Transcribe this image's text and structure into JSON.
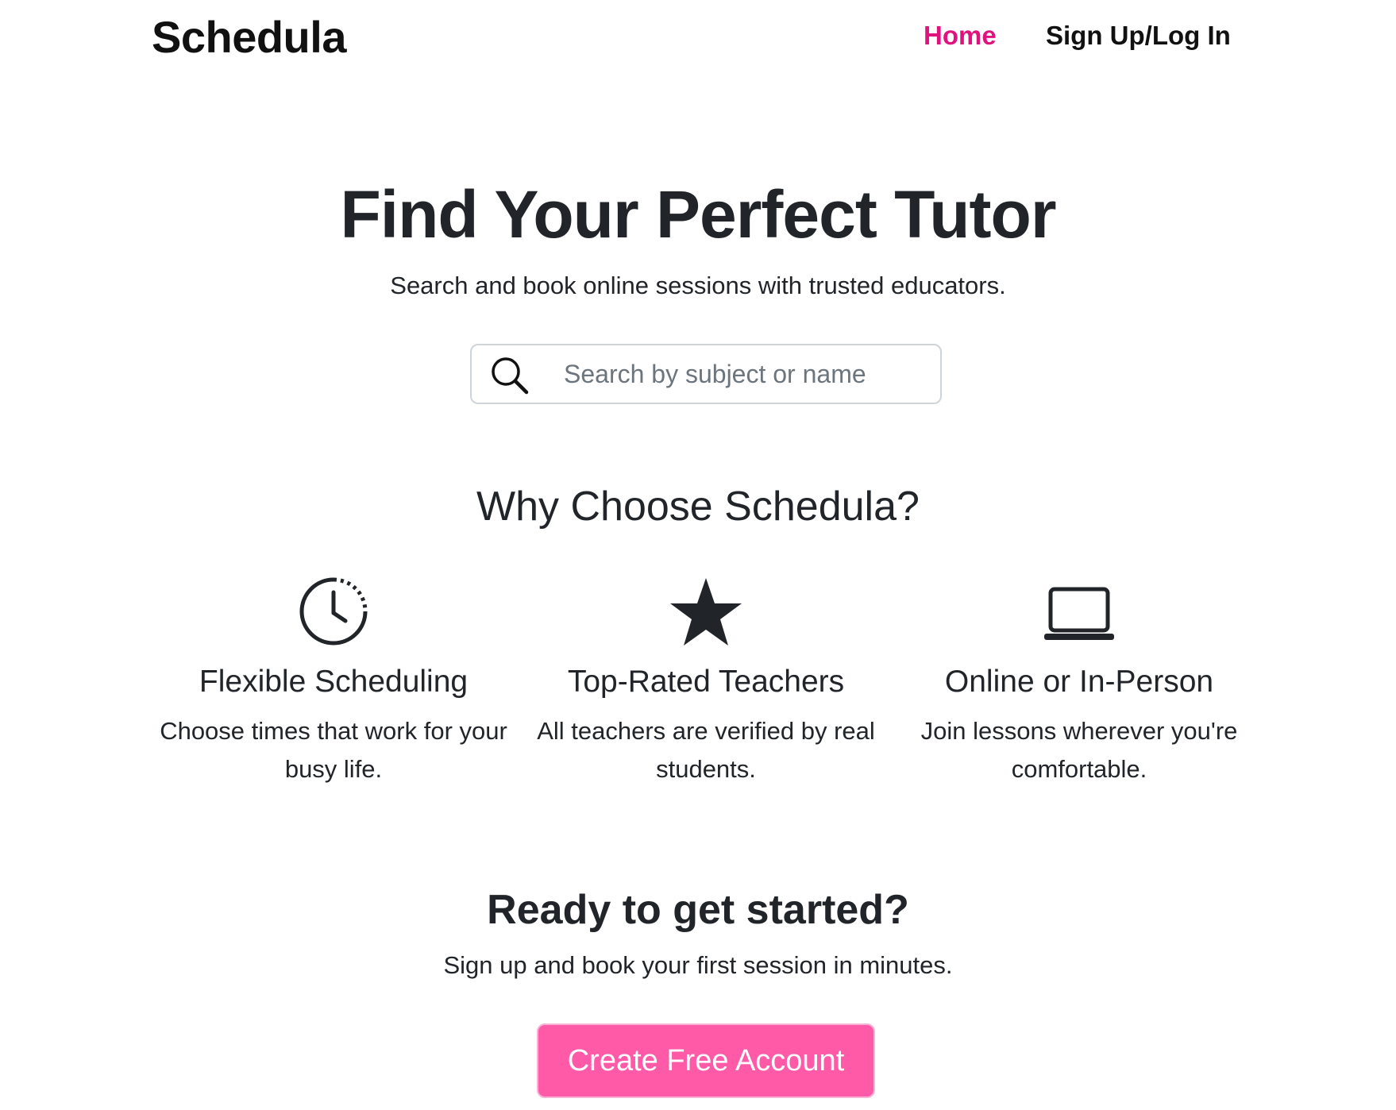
{
  "nav": {
    "brand": "Schedula",
    "home_label": "Home",
    "signup_label": "Sign Up/Log In",
    "active_color": "#e0137e"
  },
  "hero": {
    "title": "Find Your Perfect Tutor",
    "subtitle": "Search and book online sessions with trusted educators.",
    "search": {
      "placeholder": "Search by subject or name",
      "value": "",
      "icon": "search-icon"
    }
  },
  "why": {
    "title": "Why Choose Schedula?",
    "features": [
      {
        "icon": "clock-icon",
        "title": "Flexible Scheduling",
        "text": "Choose times that work for your busy life."
      },
      {
        "icon": "star-icon",
        "title": "Top-Rated Teachers",
        "text": "All teachers are verified by real students."
      },
      {
        "icon": "laptop-icon",
        "title": "Online or In-Person",
        "text": "Join lessons wherever you're comfortable."
      }
    ]
  },
  "cta": {
    "title": "Ready to get started?",
    "subtitle": "Sign up and book your first session in minutes.",
    "button_label": "Create Free Account",
    "button_color": "#ff5aa8"
  }
}
